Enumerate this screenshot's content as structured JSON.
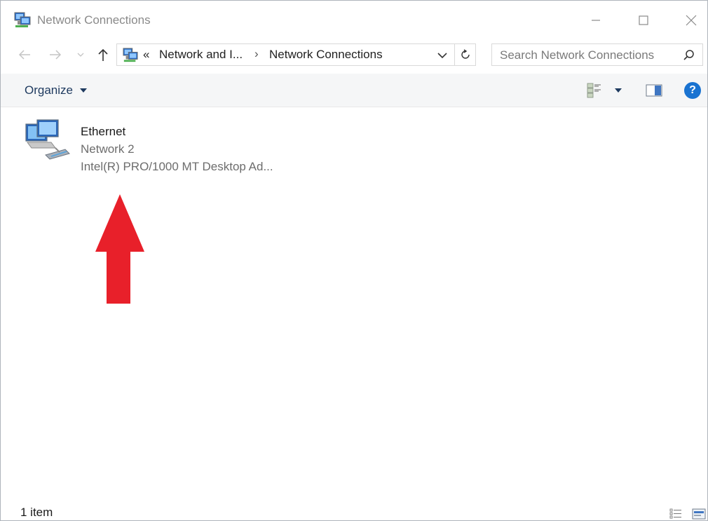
{
  "window": {
    "title": "Network Connections",
    "icon": "network-connections-icon"
  },
  "address": {
    "prefix": "«",
    "breadcrumbs": [
      "Network and I...",
      "Network Connections"
    ],
    "separator": "›"
  },
  "search": {
    "placeholder": "Search Network Connections"
  },
  "toolbar": {
    "organize_label": "Organize"
  },
  "items": [
    {
      "name": "Ethernet",
      "status": "Network 2",
      "device": "Intel(R) PRO/1000 MT Desktop Ad...",
      "icon": "network-adapter-icon"
    }
  ],
  "statusbar": {
    "count": "1 item"
  },
  "colors": {
    "accent": "#1a73d1",
    "arrow": "#e8202a",
    "toolbar_bg": "#f5f6f7"
  }
}
